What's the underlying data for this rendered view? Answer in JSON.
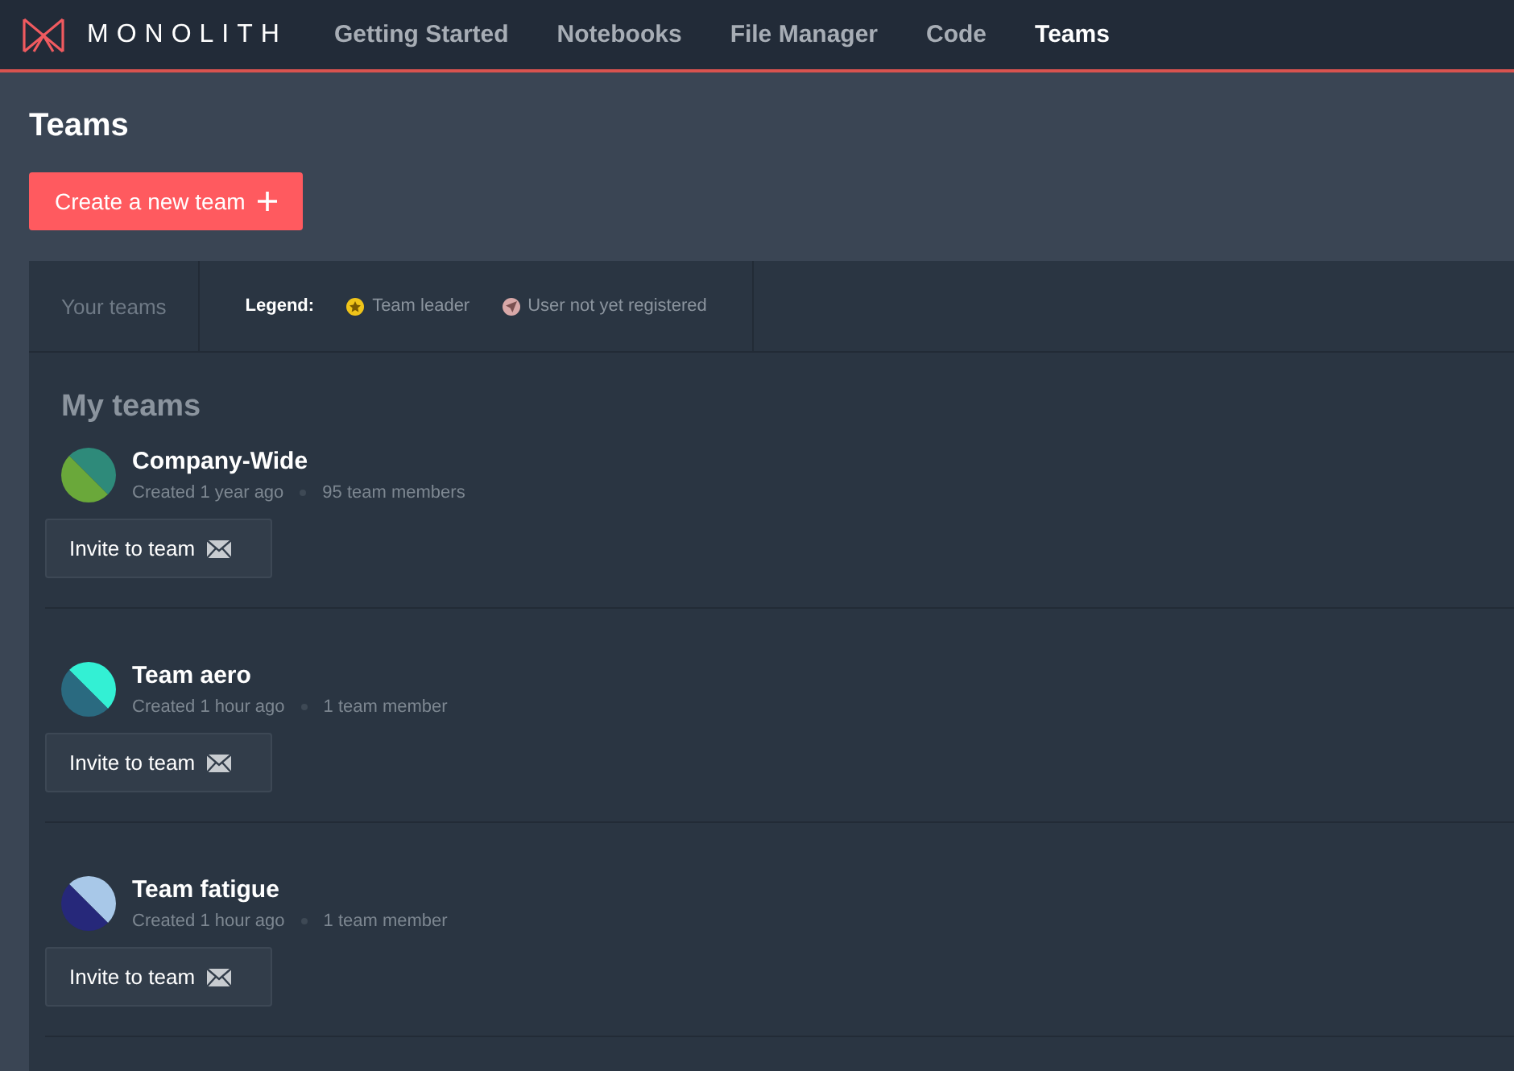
{
  "nav": {
    "brand": "MONOLITH",
    "items": [
      {
        "label": "Getting Started",
        "selected": false
      },
      {
        "label": "Notebooks",
        "selected": false
      },
      {
        "label": "File Manager",
        "selected": false
      },
      {
        "label": "Code",
        "selected": false
      },
      {
        "label": "Teams",
        "selected": true
      }
    ]
  },
  "page_title": "Teams",
  "create_button": "Create a new team",
  "tabs": {
    "label": "Your teams",
    "legend_label": "Legend:",
    "legend": [
      {
        "kind": "leader",
        "label": "Team leader",
        "color": "#f0c419"
      },
      {
        "kind": "unregistered",
        "label": "User not yet registered",
        "color": "#d8a8a8"
      }
    ]
  },
  "section_title": "My teams",
  "teams": [
    {
      "name": "Company-Wide",
      "created": "Created 1 year ago",
      "members": "95 team members",
      "avatar": [
        {
          "color": "#2e8a7a"
        },
        {
          "color": "#6aa83a"
        }
      ],
      "invite": "Invite to team"
    },
    {
      "name": "Team aero",
      "created": "Created 1 hour ago",
      "members": "1 team member",
      "avatar": [
        {
          "color": "#33f0d4"
        },
        {
          "color": "#2a6a80"
        }
      ],
      "invite": "Invite to team"
    },
    {
      "name": "Team fatigue",
      "created": "Created 1 hour ago",
      "members": "1 team member",
      "avatar": [
        {
          "color": "#a8c8e8"
        },
        {
          "color": "#26287a"
        }
      ],
      "invite": "Invite to team"
    }
  ]
}
